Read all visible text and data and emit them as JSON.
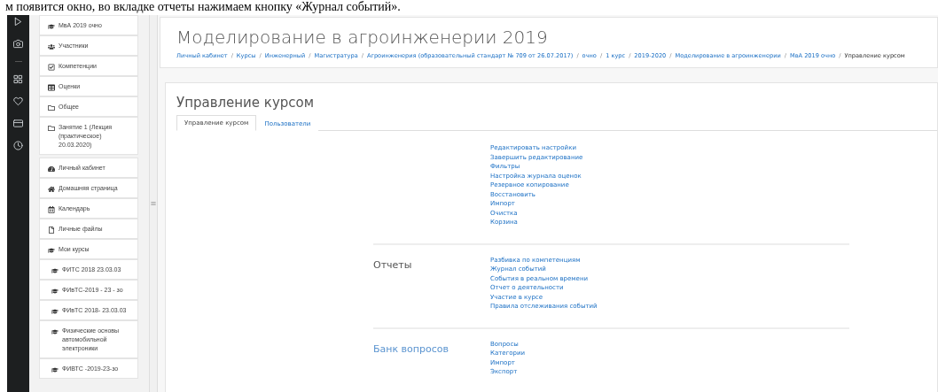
{
  "document_caption": "м появится окно, во вкладке отчеты нажимаем кнопку «Журнал событий».",
  "course_nav": [
    {
      "label": "МвА 2019 очно",
      "kind": "course"
    },
    {
      "label": "Участники",
      "kind": "users"
    },
    {
      "label": "Компетенции",
      "kind": "check"
    },
    {
      "label": "Оценки",
      "kind": "table"
    },
    {
      "label": "Общее",
      "kind": "folder"
    },
    {
      "label": "Занятие 1 (Лекция (практическое) 20.03.2020)",
      "kind": "folder"
    }
  ],
  "site_nav": [
    {
      "label": "Личный кабинет",
      "kind": "dashboard"
    },
    {
      "label": "Домашняя страница",
      "kind": "home"
    },
    {
      "label": "Календарь",
      "kind": "calendar"
    },
    {
      "label": "Личные файлы",
      "kind": "file"
    },
    {
      "label": "Мои курсы",
      "kind": "course",
      "children": [
        {
          "label": "ФИТС 2018 23.03.03",
          "kind": "course"
        },
        {
          "label": "ФИвТС-2019 - 23 - зо",
          "kind": "course"
        },
        {
          "label": "ФИвТС 2018- 23.03.03",
          "kind": "course"
        },
        {
          "label": "Физические основы автомобильной электроники",
          "kind": "course"
        },
        {
          "label": "ФИВТС -2019-23-зо",
          "kind": "course"
        }
      ]
    }
  ],
  "page_title": "Моделирование в агроинженерии 2019",
  "breadcrumb_separator": "/",
  "breadcrumb": [
    "Личный кабинет",
    "Курсы",
    "Инженерный",
    "Магистратура",
    "Агроинженерия (образовательный стандарт № 709 от 26.07.2017)",
    "очно",
    "1 курс",
    "2019-2020",
    "Моделирование в агроинженерии",
    "МвА 2019 очно",
    "Управление курсом"
  ],
  "panel_title": "Управление курсом",
  "tabs": [
    {
      "label": "Управление курсом",
      "selected": true
    },
    {
      "label": "Пользователи",
      "selected": false
    }
  ],
  "sections": [
    {
      "links": [
        "Редактировать настройки",
        "Завершить редактирование",
        "Фильтры",
        "Настройка журнала оценок",
        "Резервное копирование",
        "Восстановить",
        "Импорт",
        "Очистка",
        "Корзина"
      ]
    },
    {
      "title": "Отчеты",
      "title_link": false,
      "links": [
        "Разбивка по компетенциям",
        "Журнал событий",
        "События в реальном времени",
        "Отчет о деятельности",
        "Участие в курсе",
        "Правила отслеживания событий"
      ]
    },
    {
      "title": "Банк вопросов",
      "title_link": true,
      "links": [
        "Вопросы",
        "Категории",
        "Импорт",
        "Экспорт"
      ]
    }
  ]
}
